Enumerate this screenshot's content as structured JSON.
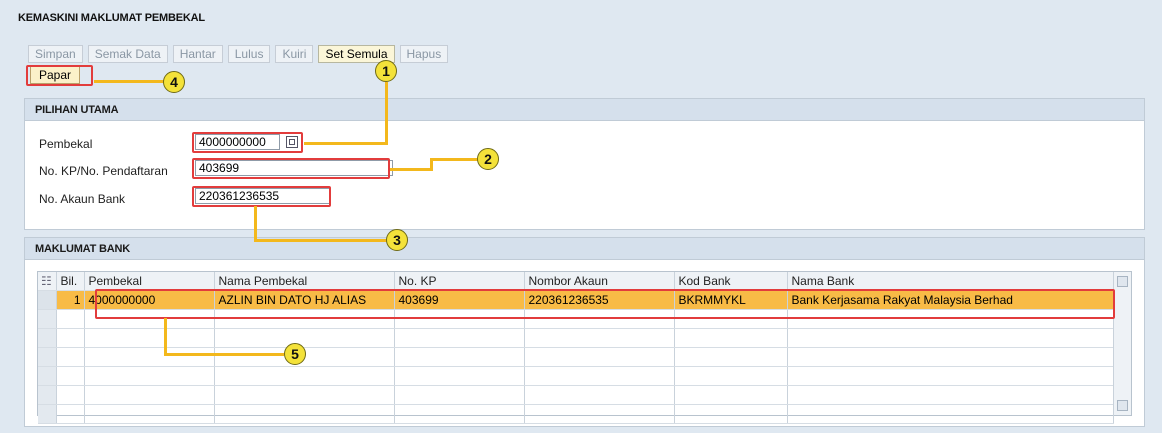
{
  "page": {
    "title": "KEMASKINI MAKLUMAT PEMBEKAL"
  },
  "toolbar": {
    "buttons": [
      {
        "label": "Simpan",
        "enabled": false
      },
      {
        "label": "Semak Data",
        "enabled": false
      },
      {
        "label": "Hantar",
        "enabled": false
      },
      {
        "label": "Lulus",
        "enabled": false
      },
      {
        "label": "Kuiri",
        "enabled": false
      },
      {
        "label": "Set Semula",
        "enabled": true
      },
      {
        "label": "Hapus",
        "enabled": false
      }
    ],
    "papar": "Papar"
  },
  "pilihan": {
    "title": "PILIHAN UTAMA",
    "pembekal": {
      "label": "Pembekal",
      "value": "4000000000"
    },
    "kp": {
      "label": "No. KP/No. Pendaftaran",
      "value": "403699"
    },
    "akaun": {
      "label": "No. Akaun Bank",
      "value": "220361236535"
    }
  },
  "bank": {
    "title": "MAKLUMAT BANK",
    "columns": [
      "Bil.",
      "Pembekal",
      "Nama Pembekal",
      "No. KP",
      "Nombor Akaun",
      "Kod Bank",
      "Nama Bank"
    ],
    "rows": [
      [
        "1",
        "4000000000",
        "AZLIN BIN DATO HJ ALIAS",
        "403699",
        "220361236535",
        "BKRMMYKL",
        "Bank Kerjasama Rakyat Malaysia Berhad"
      ]
    ]
  },
  "annotations": [
    "1",
    "2",
    "3",
    "4",
    "5"
  ],
  "colors": {
    "highlight_row": "#f8bb46",
    "annotation_box": "#e23c3c",
    "leader": "#f3b81c",
    "bubble": "#f4e23a"
  }
}
